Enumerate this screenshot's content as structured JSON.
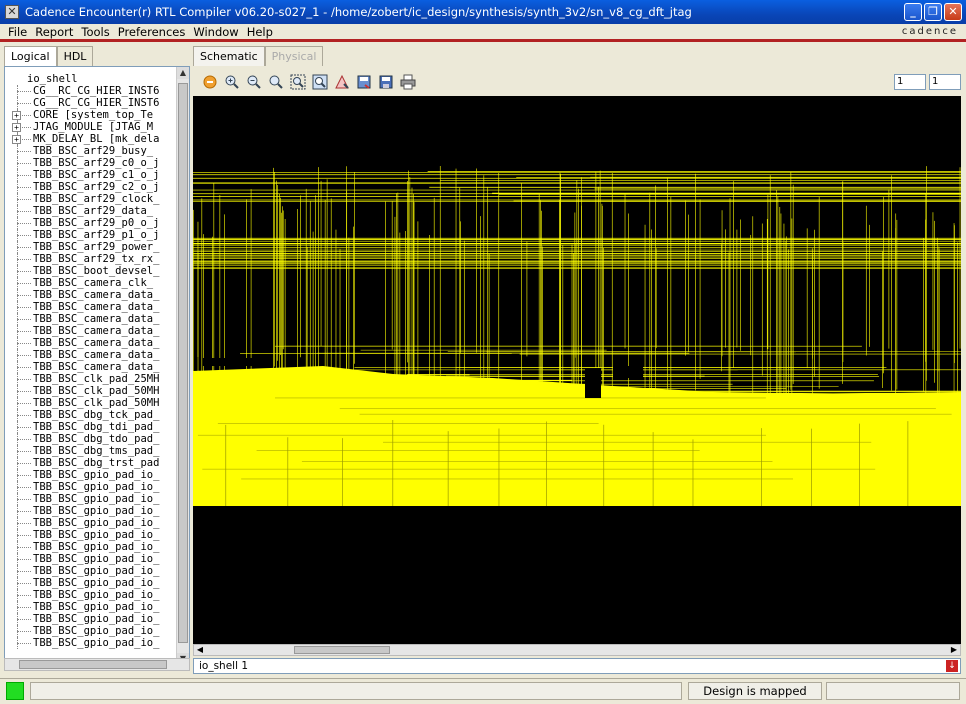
{
  "window": {
    "title": "Cadence Encounter(r) RTL Compiler v06.20-s027_1 - /home/zobert/ic_design/synthesis/synth_3v2/sn_v8_cg_dft_jtag"
  },
  "menu": {
    "items": [
      "File",
      "Report",
      "Tools",
      "Preferences",
      "Window",
      "Help"
    ],
    "brand": "cadence"
  },
  "left_tabs": [
    "Logical",
    "HDL"
  ],
  "tree": {
    "root": "io_shell",
    "items": [
      {
        "label": "CG__RC_CG_HIER_INST6",
        "expandable": false
      },
      {
        "label": "CG__RC_CG_HIER_INST6",
        "expandable": false
      },
      {
        "label": "CORE [system_top_Te",
        "expandable": true
      },
      {
        "label": "JTAG_MODULE [JTAG_M",
        "expandable": true
      },
      {
        "label": "MK_DELAY_BL [mk_dela",
        "expandable": true
      },
      {
        "label": "TBB_BSC_arf29_busy_",
        "expandable": false
      },
      {
        "label": "TBB_BSC_arf29_c0_o_j",
        "expandable": false
      },
      {
        "label": "TBB_BSC_arf29_c1_o_j",
        "expandable": false
      },
      {
        "label": "TBB_BSC_arf29_c2_o_j",
        "expandable": false
      },
      {
        "label": "TBB_BSC_arf29_clock_",
        "expandable": false
      },
      {
        "label": "TBB_BSC_arf29_data_",
        "expandable": false
      },
      {
        "label": "TBB_BSC_arf29_p0_o_j",
        "expandable": false
      },
      {
        "label": "TBB_BSC_arf29_p1_o_j",
        "expandable": false
      },
      {
        "label": "TBB_BSC_arf29_power_",
        "expandable": false
      },
      {
        "label": "TBB_BSC_arf29_tx_rx_",
        "expandable": false
      },
      {
        "label": "TBB_BSC_boot_devsel_",
        "expandable": false
      },
      {
        "label": "TBB_BSC_camera_clk_",
        "expandable": false
      },
      {
        "label": "TBB_BSC_camera_data_",
        "expandable": false
      },
      {
        "label": "TBB_BSC_camera_data_",
        "expandable": false
      },
      {
        "label": "TBB_BSC_camera_data_",
        "expandable": false
      },
      {
        "label": "TBB_BSC_camera_data_",
        "expandable": false
      },
      {
        "label": "TBB_BSC_camera_data_",
        "expandable": false
      },
      {
        "label": "TBB_BSC_camera_data_",
        "expandable": false
      },
      {
        "label": "TBB_BSC_camera_data_",
        "expandable": false
      },
      {
        "label": "TBB_BSC_clk_pad_25MH",
        "expandable": false
      },
      {
        "label": "TBB_BSC_clk_pad_50MH",
        "expandable": false
      },
      {
        "label": "TBB_BSC_clk_pad_50MH",
        "expandable": false
      },
      {
        "label": "TBB_BSC_dbg_tck_pad_",
        "expandable": false
      },
      {
        "label": "TBB_BSC_dbg_tdi_pad_",
        "expandable": false
      },
      {
        "label": "TBB_BSC_dbg_tdo_pad_",
        "expandable": false
      },
      {
        "label": "TBB_BSC_dbg_tms_pad_",
        "expandable": false
      },
      {
        "label": "TBB_BSC_dbg_trst_pad",
        "expandable": false
      },
      {
        "label": "TBB_BSC_gpio_pad_io_",
        "expandable": false
      },
      {
        "label": "TBB_BSC_gpio_pad_io_",
        "expandable": false
      },
      {
        "label": "TBB_BSC_gpio_pad_io_",
        "expandable": false
      },
      {
        "label": "TBB_BSC_gpio_pad_io_",
        "expandable": false
      },
      {
        "label": "TBB_BSC_gpio_pad_io_",
        "expandable": false
      },
      {
        "label": "TBB_BSC_gpio_pad_io_",
        "expandable": false
      },
      {
        "label": "TBB_BSC_gpio_pad_io_",
        "expandable": false
      },
      {
        "label": "TBB_BSC_gpio_pad_io_",
        "expandable": false
      },
      {
        "label": "TBB_BSC_gpio_pad_io_",
        "expandable": false
      },
      {
        "label": "TBB_BSC_gpio_pad_io_",
        "expandable": false
      },
      {
        "label": "TBB_BSC_gpio_pad_io_",
        "expandable": false
      },
      {
        "label": "TBB_BSC_gpio_pad_io_",
        "expandable": false
      },
      {
        "label": "TBB_BSC_gpio_pad_io_",
        "expandable": false
      },
      {
        "label": "TBB_BSC_gpio_pad_io_",
        "expandable": false
      },
      {
        "label": "TBB_BSC_gpio_pad_io_",
        "expandable": false
      }
    ]
  },
  "right_tabs": [
    {
      "label": "Schematic",
      "active": true,
      "disabled": false
    },
    {
      "label": "Physical",
      "active": false,
      "disabled": true
    }
  ],
  "toolbar": {
    "icons": [
      "stop-icon",
      "zoom-in-icon",
      "zoom-out-icon",
      "zoom-previous-icon",
      "zoom-fit-icon",
      "zoom-selection-icon",
      "highlight-icon",
      "save-view-icon",
      "save-icon",
      "print-icon"
    ],
    "page_current": "1",
    "page_total": "1"
  },
  "schematic": {
    "background": "#000000",
    "wire_color": "#ffff00"
  },
  "breadcrumb": "io_shell 1",
  "status": {
    "message": "",
    "state": "Design is mapped",
    "extra": "",
    "led_color": "#22dd22"
  }
}
